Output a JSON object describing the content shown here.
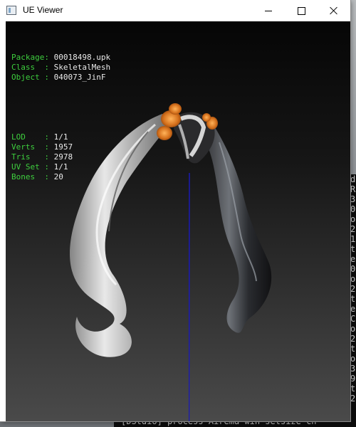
{
  "window": {
    "title": "UE Viewer"
  },
  "info": {
    "rows1": [
      {
        "label": "Package: ",
        "value": "00018498.upk"
      },
      {
        "label": "Class  : ",
        "value": "SkeletalMesh"
      },
      {
        "label": "Object : ",
        "value": "040073_JinF"
      }
    ],
    "rows2": [
      {
        "label": "LOD    : ",
        "value": "1/1"
      },
      {
        "label": "Verts  : ",
        "value": "1957"
      },
      {
        "label": "Tris   : ",
        "value": "2978"
      },
      {
        "label": "UV Set : ",
        "value": "1/1"
      },
      {
        "label": "Bones  : ",
        "value": "20"
      }
    ]
  },
  "console": {
    "bottom_line": "[DStdio] process  Airema win setsize  cn",
    "right_chars": [
      "d",
      "R",
      "3",
      "0",
      "o",
      "2",
      "1",
      "t",
      "e",
      "0",
      "o",
      "2",
      "t",
      "e",
      "C",
      "o",
      "2",
      "t",
      "o",
      "3",
      "9",
      "t",
      "2"
    ],
    "left_mark": "x"
  },
  "colors": {
    "label": "#3ecf3e",
    "value": "#eaeaea",
    "axis": "#1a1ab4"
  }
}
